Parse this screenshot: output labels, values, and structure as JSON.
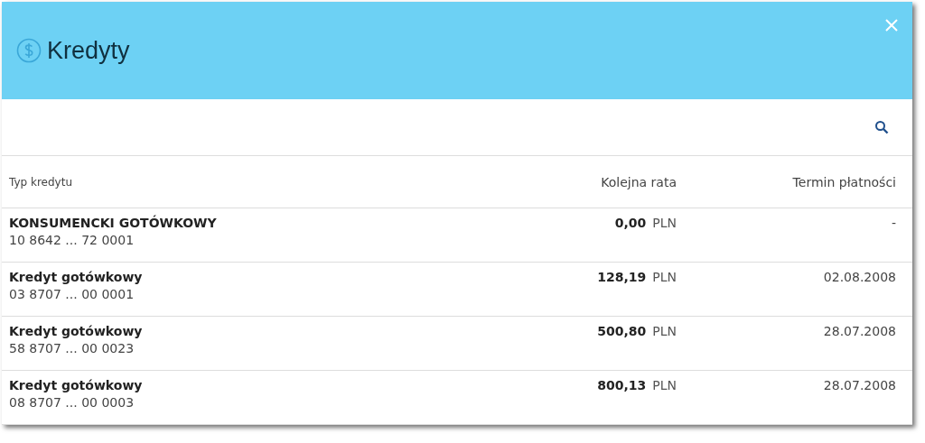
{
  "header": {
    "title": "Kredyty"
  },
  "table": {
    "columns": [
      "Typ kredytu",
      "Kolejna rata",
      "Termin płatności"
    ],
    "rows": [
      {
        "name": "KONSUMENCKI GOTÓWKOWY",
        "account": "10 8642 ... 72 0001",
        "amount": "0,00",
        "currency": "PLN",
        "due": "-"
      },
      {
        "name": "Kredyt gotówkowy",
        "account": "03 8707 ... 00 0001",
        "amount": "128,19",
        "currency": "PLN",
        "due": "02.08.2008"
      },
      {
        "name": "Kredyt gotówkowy",
        "account": "58 8707 ... 00 0023",
        "amount": "500,80",
        "currency": "PLN",
        "due": "28.07.2008"
      },
      {
        "name": "Kredyt gotówkowy",
        "account": "08 8707 ... 00 0003",
        "amount": "800,13",
        "currency": "PLN",
        "due": "28.07.2008"
      }
    ]
  }
}
